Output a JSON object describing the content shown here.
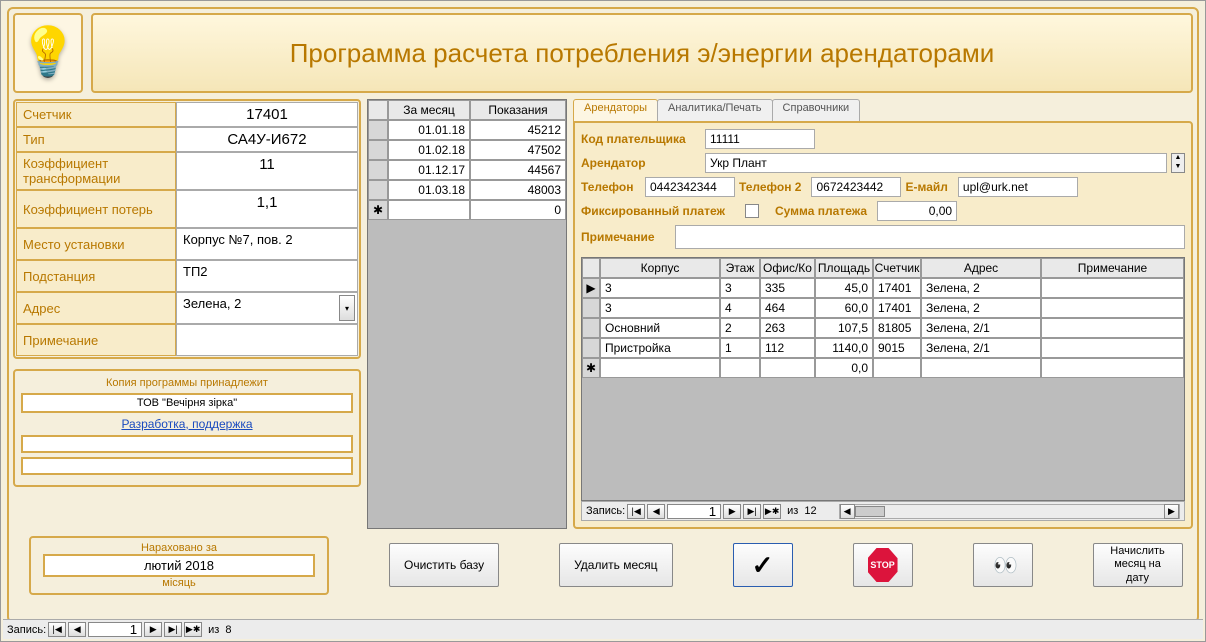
{
  "title": "Программа расчета потребления э/энергии арендаторами",
  "meter": {
    "counter_label": "Счетчик",
    "counter_value": "17401",
    "type_label": "Тип",
    "type_value": "СА4У-И672",
    "ktrans_label": "Коэффициент трансформации",
    "ktrans_value": "11",
    "kloss_label": "Коэффициент потерь",
    "kloss_value": "1,1",
    "place_label": "Место установки",
    "place_value": "Корпус №7, пов. 2",
    "substation_label": "Подстанция",
    "substation_value": "ТП2",
    "address_label": "Адрес",
    "address_value": "Зелена, 2",
    "note_label": "Примечание",
    "note_value": ""
  },
  "license": {
    "title": "Копия программы принадлежит",
    "owner": "ТОВ \"Вечірня зірка\"",
    "link": "Разработка, поддержка"
  },
  "readings": {
    "head_month": "За месяц",
    "head_value": "Показания",
    "rows": [
      {
        "date": "01.01.18",
        "val": "45212"
      },
      {
        "date": "01.02.18",
        "val": "47502"
      },
      {
        "date": "01.12.17",
        "val": "44567"
      },
      {
        "date": "01.03.18",
        "val": "48003"
      }
    ],
    "new_val": "0"
  },
  "tabs": {
    "t1": "Арендаторы",
    "t2": "Аналитика/Печать",
    "t3": "Справочники"
  },
  "tenant_form": {
    "payer_label": "Код плательщика",
    "payer_value": "11111",
    "tenant_label": "Арендатор",
    "tenant_value": "Укр Плант",
    "phone_label": "Телефон",
    "phone_value": "0442342344",
    "phone2_label": "Телефон 2",
    "phone2_value": "0672423442",
    "email_label": "Е-майл",
    "email_value": "upl@urk.net",
    "fixed_label": "Фиксированный платеж",
    "sum_label": "Сумма платежа",
    "sum_value": "0,00",
    "note_label": "Примечание",
    "note_value": ""
  },
  "subgrid": {
    "head": {
      "korp": "Корпус",
      "et": "Этаж",
      "of": "Офис/Ко",
      "pl": "Площадь",
      "sch": "Счетчик",
      "adr": "Адрес",
      "prim": "Примечание"
    },
    "rows": [
      {
        "korp": "3",
        "et": "3",
        "of": "335",
        "pl": "45,0",
        "sch": "17401",
        "adr": "Зелена, 2",
        "prim": ""
      },
      {
        "korp": "3",
        "et": "4",
        "of": "464",
        "pl": "60,0",
        "sch": "17401",
        "adr": "Зелена, 2",
        "prim": ""
      },
      {
        "korp": "Основний",
        "et": "2",
        "of": "263",
        "pl": "107,5",
        "sch": "81805",
        "adr": "Зелена, 2/1",
        "prim": ""
      },
      {
        "korp": "Пристройка",
        "et": "1",
        "of": "112",
        "pl": "1140,0",
        "sch": "9015",
        "adr": "Зелена, 2/1",
        "prim": ""
      }
    ],
    "new_pl": "0,0"
  },
  "nav": {
    "record_label": "Запись:",
    "of_label": "из",
    "inner_pos": "1",
    "inner_total": "12",
    "outer_pos": "1",
    "outer_total": "8"
  },
  "buttons": {
    "clear_db": "Очистить базу",
    "del_month": "Удалить месяц",
    "stop": "STOP",
    "calc_date": "Начислить месяц на дату"
  },
  "calc": {
    "top": "Нараховано за",
    "month": "лютий 2018",
    "bottom": "місяць"
  }
}
